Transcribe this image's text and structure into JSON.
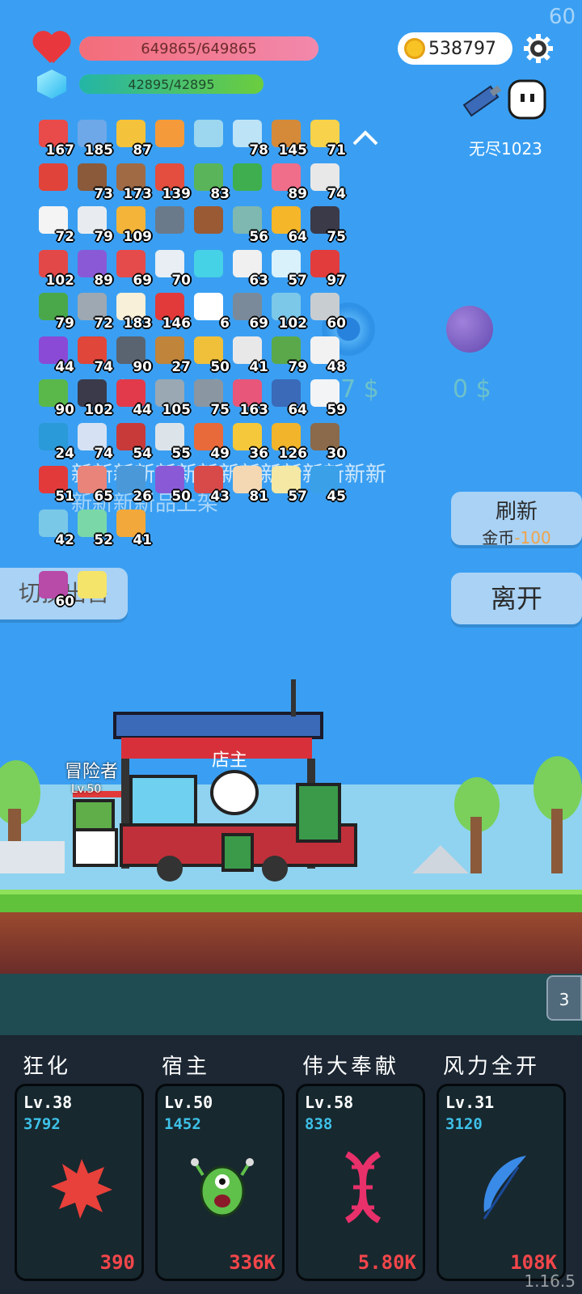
{
  "fps": "60",
  "version": "1.16.5",
  "hp": {
    "text": "649865/649865",
    "fraction": 1.0
  },
  "mp": {
    "text": "42895/42895",
    "fraction": 1.0
  },
  "gold": "538797",
  "mode_label": "无尽1023",
  "items": [
    {
      "count": "167",
      "color": "#e94a4a"
    },
    {
      "count": "185",
      "color": "#6fa8e8"
    },
    {
      "count": "87",
      "color": "#f5c23b"
    },
    {
      "count": "",
      "color": "#f59a3b"
    },
    {
      "count": "",
      "color": "#9cd7ef"
    },
    {
      "count": "78",
      "color": "#bde3f7"
    },
    {
      "count": "145",
      "color": "#d58a3a"
    },
    {
      "count": "71",
      "color": "#f7d24a"
    },
    {
      "count": "",
      "color": "#e0433a"
    },
    {
      "count": "73",
      "color": "#8a5a3a"
    },
    {
      "count": "173",
      "color": "#a06a44"
    },
    {
      "count": "139",
      "color": "#e34e3e"
    },
    {
      "count": "83",
      "color": "#5ab55a"
    },
    {
      "count": "",
      "color": "#3fae4e"
    },
    {
      "count": "89",
      "color": "#f06e8a"
    },
    {
      "count": "74",
      "color": "#e8e8e8"
    },
    {
      "count": "72",
      "color": "#f4f4f4"
    },
    {
      "count": "79",
      "color": "#e8ecf0"
    },
    {
      "count": "109",
      "color": "#f4b43a"
    },
    {
      "count": "",
      "color": "#6b7a8a"
    },
    {
      "count": "",
      "color": "#9a5a34"
    },
    {
      "count": "56",
      "color": "#7fb8b0"
    },
    {
      "count": "64",
      "color": "#f5b62a"
    },
    {
      "count": "75",
      "color": "#3a3a48"
    },
    {
      "count": "102",
      "color": "#e24848"
    },
    {
      "count": "89",
      "color": "#8a5ad6"
    },
    {
      "count": "69",
      "color": "#e54b4b"
    },
    {
      "count": "70",
      "color": "#e8eef4"
    },
    {
      "count": "",
      "color": "#45d1e6"
    },
    {
      "count": "63",
      "color": "#f0f0f0"
    },
    {
      "count": "57",
      "color": "#d9f1fb"
    },
    {
      "count": "97",
      "color": "#e23c3c"
    },
    {
      "count": "79",
      "color": "#4aa84a"
    },
    {
      "count": "72",
      "color": "#9ea8b2"
    },
    {
      "count": "183",
      "color": "#f8f0d8"
    },
    {
      "count": "146",
      "color": "#e23a3a"
    },
    {
      "count": "6",
      "color": "#ffffff"
    },
    {
      "count": "69",
      "color": "#7a8a9a"
    },
    {
      "count": "102",
      "color": "#7cc8e8"
    },
    {
      "count": "60",
      "color": "#c8cdd2"
    },
    {
      "count": "44",
      "color": "#8a4ad6"
    },
    {
      "count": "74",
      "color": "#e0463a"
    },
    {
      "count": "90",
      "color": "#5a6470"
    },
    {
      "count": "27",
      "color": "#c0843a"
    },
    {
      "count": "50",
      "color": "#f0c03a"
    },
    {
      "count": "41",
      "color": "#e8e8e8"
    },
    {
      "count": "79",
      "color": "#5aa84a"
    },
    {
      "count": "48",
      "color": "#f2f2f2"
    },
    {
      "count": "90",
      "color": "#5ab84a"
    },
    {
      "count": "102",
      "color": "#3a3a4a"
    },
    {
      "count": "44",
      "color": "#e23a4a"
    },
    {
      "count": "105",
      "color": "#9aa8b4"
    },
    {
      "count": "75",
      "color": "#8a96a2"
    },
    {
      "count": "163",
      "color": "#e8567a"
    },
    {
      "count": "64",
      "color": "#3a6ab8"
    },
    {
      "count": "59",
      "color": "#f2f4f6"
    },
    {
      "count": "24",
      "color": "#2a9ad8"
    },
    {
      "count": "74",
      "color": "#d6e2f4"
    },
    {
      "count": "54",
      "color": "#c83a3a"
    },
    {
      "count": "55",
      "color": "#dce4ea"
    },
    {
      "count": "49",
      "color": "#e86a3a"
    },
    {
      "count": "36",
      "color": "#f4c83a"
    },
    {
      "count": "126",
      "color": "#f2b42a"
    },
    {
      "count": "30",
      "color": "#8a6a4a"
    },
    {
      "count": "51",
      "color": "#e23a3a"
    },
    {
      "count": "65",
      "color": "#e8847a"
    },
    {
      "count": "26",
      "color": "#4a98d8"
    },
    {
      "count": "50",
      "color": "#8a5ad6"
    },
    {
      "count": "43",
      "color": "#d84a4a"
    },
    {
      "count": "81",
      "color": "#f4d8b4"
    },
    {
      "count": "57",
      "color": "#f4e8a4"
    },
    {
      "count": "45",
      "color": "#3aa0e8"
    },
    {
      "count": "42",
      "color": "#7ac8e8"
    },
    {
      "count": "52",
      "color": "#7ad8a8"
    },
    {
      "count": "41",
      "color": "#f2a83a"
    }
  ],
  "extra_items": [
    {
      "count": "60",
      "color": "#b84aa8"
    },
    {
      "count": "",
      "color": "#f4e46a"
    }
  ],
  "shop_ghost": {
    "prices": [
      "0 $",
      "0 $",
      "57 $",
      "0 $"
    ],
    "marquee": "新新新新新新新新新新新新新新新",
    "marquee2": "新新新新品上架"
  },
  "buttons": {
    "refresh": "刷新",
    "refresh_cost_label": "金币",
    "refresh_cost": "-100",
    "leave": "离开",
    "switch": "切换出售"
  },
  "scene": {
    "shop_label": "店主",
    "adventurer_label": "冒险者",
    "adventurer_level": "Lv.50"
  },
  "side_tab": "3",
  "skills": [
    {
      "name": "狂化",
      "level": "Lv.38",
      "value": "3792",
      "cost": "390",
      "icon": "splat-icon",
      "color": "#e8403a"
    },
    {
      "name": "宿主",
      "level": "Lv.50",
      "value": "1452",
      "cost": "336K",
      "icon": "monster-icon",
      "color": "#5fc04a"
    },
    {
      "name": "伟大奉献",
      "level": "Lv.58",
      "value": "838",
      "cost": "5.80K",
      "icon": "dna-icon",
      "color": "#e8306a"
    },
    {
      "name": "风力全开",
      "level": "Lv.31",
      "value": "3120",
      "cost": "108K",
      "icon": "feather-icon",
      "color": "#3a8ae8"
    }
  ]
}
